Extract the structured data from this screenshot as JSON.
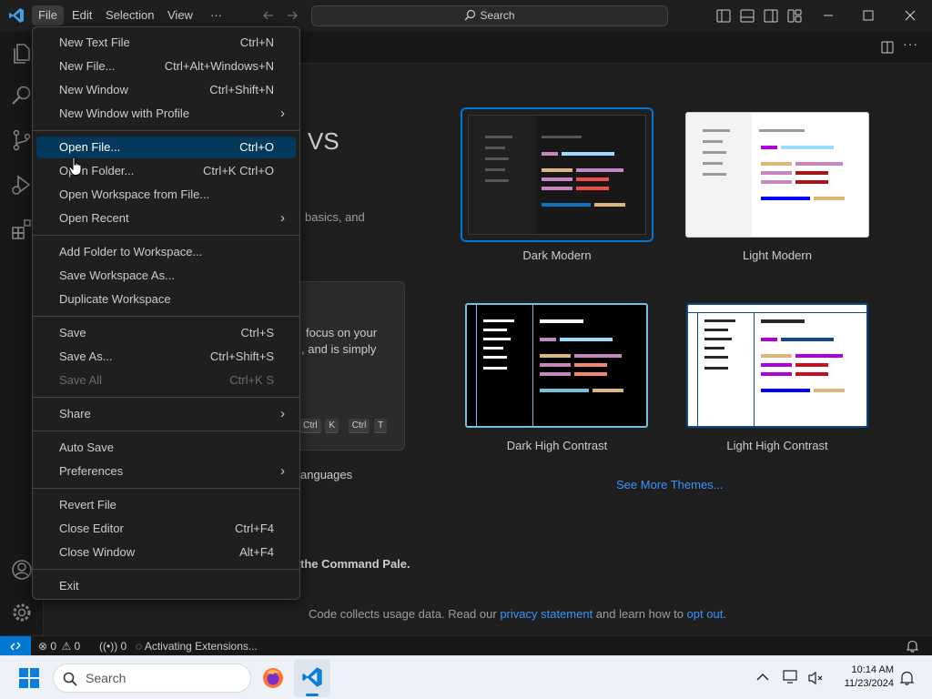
{
  "menubar": {
    "items": [
      "File",
      "Edit",
      "Selection",
      "View",
      "···"
    ],
    "search_placeholder": "Search"
  },
  "welcome": {
    "heading_fragment": "VS",
    "desc_fragment": "basics, and",
    "card_text_line1": "focus on your",
    "card_text_line2": ", and is simply",
    "keys": [
      "Ctrl",
      "+",
      "K",
      "Ctrl",
      "+",
      "T"
    ],
    "languages_fragment": "anguages",
    "command_fragment": "the Command Pale.",
    "see_more": "See More Themes...",
    "footer_prefix": "Code collects usage data. Read our ",
    "footer_link1": "privacy statement",
    "footer_mid": " and learn how to ",
    "footer_link2": "opt out",
    "footer_suffix": "."
  },
  "themes": [
    {
      "name": "Dark Modern"
    },
    {
      "name": "Light Modern"
    },
    {
      "name": "Dark High Contrast"
    },
    {
      "name": "Light High Contrast"
    }
  ],
  "file_menu": {
    "groups": [
      [
        {
          "label": "New Text File",
          "key": "Ctrl+N"
        },
        {
          "label": "New File...",
          "key": "Ctrl+Alt+Windows+N"
        },
        {
          "label": "New Window",
          "key": "Ctrl+Shift+N"
        },
        {
          "label": "New Window with Profile",
          "key": "",
          "submenu": true
        }
      ],
      [
        {
          "label": "Open File...",
          "key": "Ctrl+O",
          "highlighted": true
        },
        {
          "label": "Open Folder...",
          "key": "Ctrl+K Ctrl+O"
        },
        {
          "label": "Open Workspace from File...",
          "key": ""
        },
        {
          "label": "Open Recent",
          "key": "",
          "submenu": true
        }
      ],
      [
        {
          "label": "Add Folder to Workspace...",
          "key": ""
        },
        {
          "label": "Save Workspace As...",
          "key": ""
        },
        {
          "label": "Duplicate Workspace",
          "key": ""
        }
      ],
      [
        {
          "label": "Save",
          "key": "Ctrl+S"
        },
        {
          "label": "Save As...",
          "key": "Ctrl+Shift+S"
        },
        {
          "label": "Save All",
          "key": "Ctrl+K S",
          "disabled": true
        }
      ],
      [
        {
          "label": "Share",
          "key": "",
          "submenu": true
        }
      ],
      [
        {
          "label": "Auto Save",
          "key": ""
        },
        {
          "label": "Preferences",
          "key": "",
          "submenu": true
        }
      ],
      [
        {
          "label": "Revert File",
          "key": ""
        },
        {
          "label": "Close Editor",
          "key": "Ctrl+F4"
        },
        {
          "label": "Close Window",
          "key": "Alt+F4"
        }
      ],
      [
        {
          "label": "Exit",
          "key": ""
        }
      ]
    ]
  },
  "statusbar": {
    "errors": "0",
    "warnings": "0",
    "ports": "0",
    "activity": "Activating Extensions..."
  },
  "taskbar": {
    "search_placeholder": "Search",
    "time": "10:14 AM",
    "date": "11/23/2024"
  },
  "colors": {
    "accent": "#0078d4",
    "menu_highlight": "#04395e",
    "link": "#3794ff"
  }
}
